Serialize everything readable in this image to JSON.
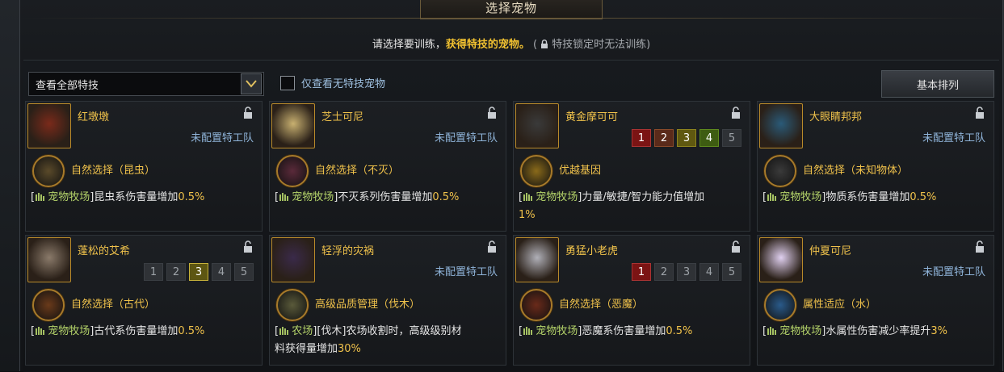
{
  "window": {
    "title": "选择宠物"
  },
  "notice": {
    "text": "请选择要训练，",
    "highlight": "获得特技的宠物。",
    "sub": "特技锁定时无法训练)"
  },
  "filter": {
    "dropdown_label": "查看全部特技",
    "checkbox_label": "仅查看无特技宠物",
    "sort_label": "基本排列"
  },
  "pets": [
    {
      "name": "红墩墩",
      "status": "未配置特工队",
      "levels": null,
      "skill": "自然选择（昆虫）",
      "tag": "宠物牧场",
      "desc": "昆虫系伤害量增加",
      "value": "0.5%",
      "desc2": ""
    },
    {
      "name": "芝士可尼",
      "status": "未配置特工队",
      "levels": null,
      "skill": "自然选择（不灭）",
      "tag": "宠物牧场",
      "desc": "不灭系列伤害量增加",
      "value": "0.5%",
      "desc2": ""
    },
    {
      "name": "黄金摩可可",
      "status": "",
      "levels": [
        "1",
        "2",
        "3",
        "4",
        "5"
      ],
      "skill": "优越基因",
      "tag": "宠物牧场",
      "desc": "力量/敏捷/智力能力值增加",
      "value": "",
      "desc2": "1%"
    },
    {
      "name": "大眼睛邦邦",
      "status": "未配置特工队",
      "levels": null,
      "skill": "自然选择（未知物体）",
      "tag": "宠物牧场",
      "desc": "物质系伤害量增加",
      "value": "0.5%",
      "desc2": ""
    },
    {
      "name": "蓬松的艾希",
      "status": "",
      "levels": [
        "1",
        "2",
        "3",
        "4",
        "5"
      ],
      "skill": "自然选择（古代）",
      "tag": "宠物牧场",
      "desc": "古代系伤害量增加",
      "value": "0.5%",
      "desc2": ""
    },
    {
      "name": "轻浮的灾祸",
      "status": "未配置特工队",
      "levels": null,
      "skill": "高级品质管理（伐木）",
      "tag": "农场",
      "desc": "[伐木]农场收割时，高级级别材",
      "value": "",
      "desc2": "料获得量增加",
      "value2": "30%"
    },
    {
      "name": "勇猛小老虎",
      "status": "",
      "levels": [
        "1",
        "2",
        "3",
        "4",
        "5"
      ],
      "skill": "自然选择（恶魔）",
      "tag": "宠物牧场",
      "desc": "恶魔系伤害量增加",
      "value": "0.5%",
      "desc2": ""
    },
    {
      "name": "仲夏可尼",
      "status": "未配置特工队",
      "levels": null,
      "skill": "属性适应（水）",
      "tag": "宠物牧场",
      "desc": "水属性伤害减少率提升",
      "value": "3%",
      "desc2": ""
    }
  ],
  "colors": {
    "accent_gold": "#f0c24b",
    "team_blue": "#8fb4d9",
    "tag_green": "#b5d46a"
  }
}
